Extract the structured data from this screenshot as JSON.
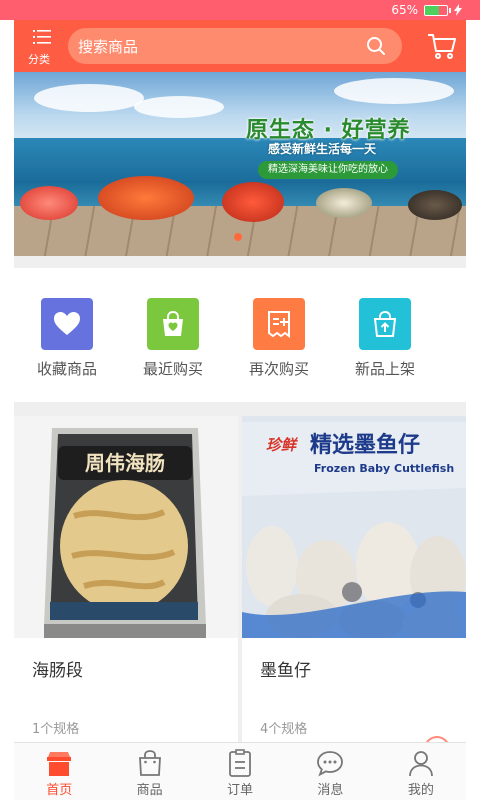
{
  "status_bar": {
    "battery_text": "65%",
    "battery_level": 0.65
  },
  "header": {
    "menu_label": "分类",
    "search_placeholder": "搜索商品"
  },
  "banner": {
    "title": "原生态 · 好营养",
    "subtitle": "感受新鲜生活每一天",
    "tag": "精选深海美味让你吃的放心"
  },
  "quick_entries": [
    {
      "label": "收藏商品",
      "color": "#6673df",
      "icon": "heart-icon"
    },
    {
      "label": "最近购买",
      "color": "#7bc73d",
      "icon": "shopping-bag-icon"
    },
    {
      "label": "再次购买",
      "color": "#ff7b44",
      "icon": "receipt-icon"
    },
    {
      "label": "新品上架",
      "color": "#22c1d8",
      "icon": "new-bag-icon"
    }
  ],
  "products": [
    {
      "name": "海肠段",
      "spec": "1个规格",
      "package_text": "周伟海肠"
    },
    {
      "name": "墨鱼仔",
      "spec": "4个规格",
      "package_text": "精选墨鱼仔",
      "package_en": "Frozen Baby Cuttlefish",
      "brand": "珍鲜"
    }
  ],
  "tabs": [
    {
      "label": "首页",
      "icon": "home-icon",
      "active": true
    },
    {
      "label": "商品",
      "icon": "shopping-bag-icon",
      "active": false
    },
    {
      "label": "订单",
      "icon": "order-icon",
      "active": false
    },
    {
      "label": "消息",
      "icon": "message-icon",
      "active": false
    },
    {
      "label": "我的",
      "icon": "user-icon",
      "active": false
    }
  ],
  "colors": {
    "accent": "#ff5d43",
    "active_tab": "#ff4b2e",
    "status_bar": "#ff5e6e"
  }
}
